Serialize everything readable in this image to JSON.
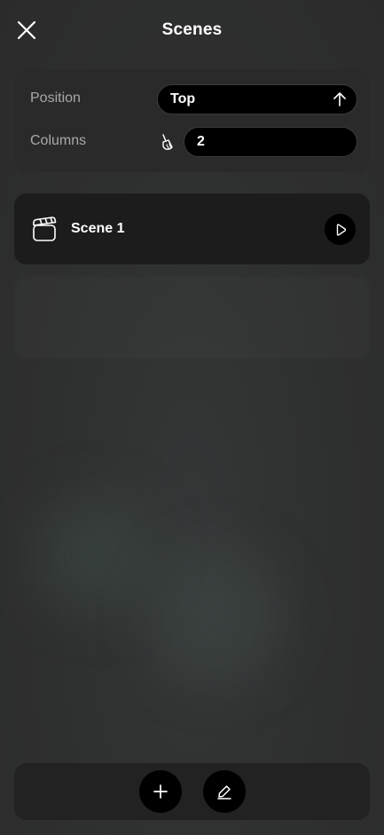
{
  "header": {
    "title": "Scenes",
    "close_icon": "close-icon"
  },
  "settings": {
    "position": {
      "label": "Position",
      "value": "Top",
      "icon": "arrow-up-icon"
    },
    "columns": {
      "label": "Columns",
      "value": "2",
      "icon": "brush-icon"
    }
  },
  "scenes": [
    {
      "name": "Scene 1",
      "icon": "clapperboard-icon",
      "action_icon": "play-icon"
    }
  ],
  "bottom_bar": {
    "add_icon": "plus-icon",
    "edit_icon": "pencil-icon"
  },
  "colors": {
    "background": "#2f3030",
    "card": "#2a2a2a",
    "scene_card": "#1c1c1c",
    "control": "#000000",
    "text": "#ffffff",
    "label": "#a8a8a8"
  }
}
